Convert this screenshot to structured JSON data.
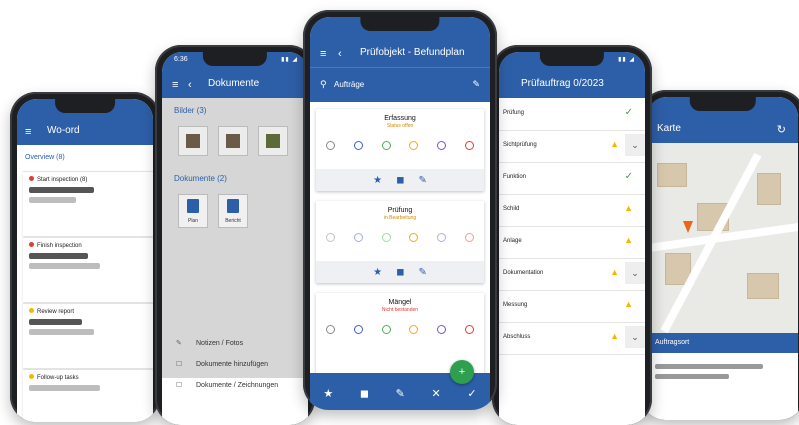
{
  "phones": {
    "p1": {
      "title": "Wo-ord",
      "time": "",
      "section": "Overview (8)",
      "cards": [
        {
          "label": "Start inspection (8)",
          "priority": "red"
        },
        {
          "label": "Finish inspection",
          "priority": "red"
        },
        {
          "label": "Review report",
          "priority": "yellow"
        },
        {
          "label": "Follow-up tasks",
          "priority": "yellow"
        }
      ]
    },
    "p2": {
      "time": "6:36",
      "title": "Dokumente",
      "images_label": "Bilder (3)",
      "docs_label": "Dokumente (2)",
      "doc_names": [
        "Plan",
        "Bericht"
      ],
      "menu": [
        {
          "icon": "✎",
          "label": "Notizen / Fotos"
        },
        {
          "icon": "☐",
          "label": "Dokumente hinzufügen"
        },
        {
          "icon": "☐",
          "label": "Dokumente / Zeichnungen"
        }
      ]
    },
    "p3": {
      "title": "Prüfobjekt - Befundplan",
      "sub": "Aufträge",
      "cards": [
        {
          "title": "Erfassung",
          "subtitle": "Status offen"
        },
        {
          "title": "Prüfung",
          "subtitle": "in Bearbeitung"
        },
        {
          "title": "Mängel",
          "subtitle": "Nicht bestanden"
        }
      ],
      "fab_icon": "+"
    },
    "p4": {
      "title": "Prüfauftrag 0/2023",
      "rows": [
        {
          "label": "Prüfung",
          "state": "ok"
        },
        {
          "label": "Sichtprüfung",
          "state": "warn"
        },
        {
          "label": "Funktion",
          "state": "ok"
        },
        {
          "label": "Schild",
          "state": "warn"
        },
        {
          "label": "Anlage",
          "state": "warn"
        },
        {
          "label": "Dokumentation",
          "state": "warn"
        },
        {
          "label": "Messung",
          "state": "warn"
        },
        {
          "label": "Abschluss",
          "state": "warn"
        }
      ]
    },
    "p5": {
      "title": "Karte",
      "info": "Auftragsort"
    }
  },
  "colors": {
    "primary": "#2d5fa8",
    "green": "#2e9e4f",
    "warn": "#f5b800",
    "red": "#e53935"
  }
}
